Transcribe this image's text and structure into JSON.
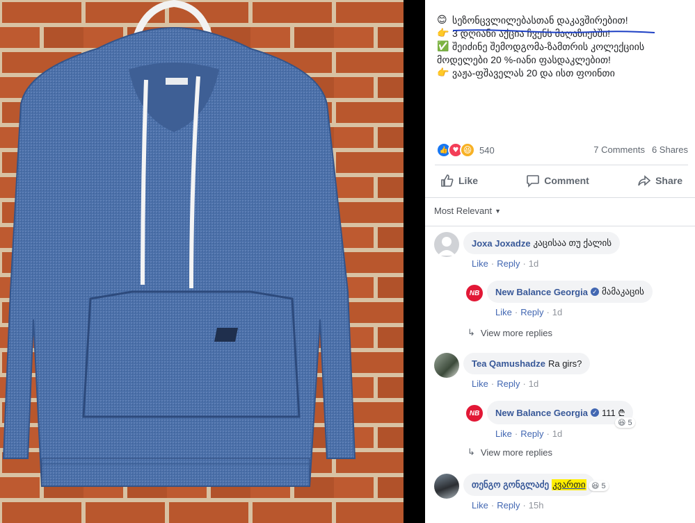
{
  "post": {
    "lines": [
      {
        "icon": "😊",
        "text": "სეზონცვლილებასთან დაკავშირებით!"
      },
      {
        "icon": "👉",
        "text": "3 დღიანი აქცია ჩვენს მაღაზიებში!"
      },
      {
        "icon": "✅",
        "text": "შეიძინე შემოდგომა-ზამთრის კოლექციის"
      },
      {
        "icon": "",
        "text": "მოდელები 20 %-იანი ფასდაკლებით!"
      },
      {
        "icon": "👉",
        "text": "ვაჟა-ფშაველას 20 და ისთ ფოინთი"
      }
    ],
    "reaction_count": "540",
    "comments_label": "7 Comments",
    "shares_label": "6 Shares"
  },
  "actions": {
    "like": "Like",
    "comment": "Comment",
    "share": "Share"
  },
  "filter_label": "Most Relevant",
  "comments": [
    {
      "name": "Joxa Joxadze",
      "text": "კაცისაა თუ ქალის",
      "like": "Like",
      "reply": "Reply",
      "time": "1d"
    },
    {
      "name": "New Balance Georgia",
      "text": "მამაკაცის",
      "like": "Like",
      "reply": "Reply",
      "time": "1d"
    },
    {
      "name": "Tea Qamushadze",
      "text": "Ra girs?",
      "like": "Like",
      "reply": "Reply",
      "time": "1d"
    },
    {
      "name": "New Balance Georgia",
      "text": "111 ₾",
      "like": "Like",
      "reply": "Reply",
      "time": "1d",
      "reaction_count": "5"
    },
    {
      "name": "თენგო გონგლაძე",
      "text": "კვართი",
      "like": "Like",
      "reply": "Reply",
      "time": "15h",
      "reaction_count": "5"
    }
  ],
  "view_more_replies": "View more replies",
  "dot": "·",
  "icons": {
    "like": "like-thumb-icon",
    "love": "heart-icon",
    "haha": "laughing-face-icon",
    "share": "share-arrow-icon",
    "comment": "speech-bubble-icon",
    "reply_arrow": "reply-arrow-icon",
    "dropdown": "caret-down-icon",
    "verified": "verified-check-icon"
  },
  "colors": {
    "link": "#385898",
    "brand_red": "#e21836",
    "meta": "#90949c",
    "accent": "#4267b2"
  }
}
